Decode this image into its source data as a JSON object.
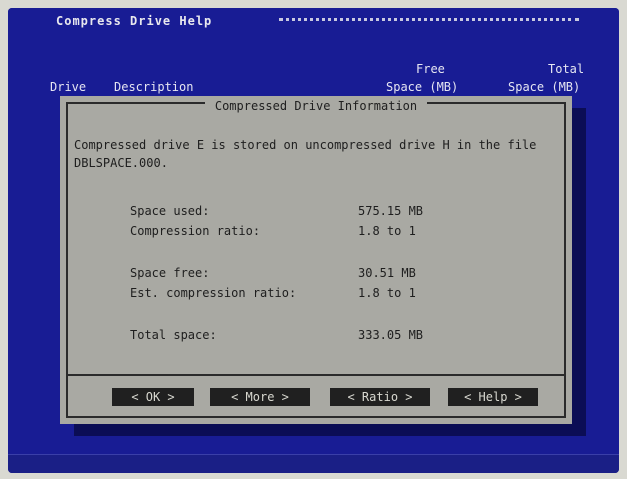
{
  "menubar": {
    "title": "Compress Drive Help"
  },
  "header": {
    "col_drive": "Drive",
    "col_desc": "Description",
    "col_free_1": "Free",
    "col_free_2": "Space (MB)",
    "col_total_1": "Total",
    "col_total_2": "Space (MB)"
  },
  "dialog": {
    "title": "Compressed Drive Information",
    "message": "Compressed drive E is stored on uncompressed drive H in the file DBLSPACE.000.",
    "rows": [
      {
        "label": "Space used:",
        "value": "575.15 MB"
      },
      {
        "label": "Compression ratio:",
        "value": "1.8 to 1"
      },
      {
        "label": "Space free:",
        "value": "30.51 MB"
      },
      {
        "label": "Est. compression ratio:",
        "value": "1.8 to 1"
      },
      {
        "label": "Total space:",
        "value": "333.05 MB"
      }
    ],
    "buttons": {
      "ok": "< OK >",
      "more": "< More >",
      "ratio": "< Ratio >",
      "help": "< Help >"
    }
  },
  "colors": {
    "screen_bg": "#181c94",
    "dialog_bg": "#a9a9a3",
    "button_bg": "#202020"
  }
}
